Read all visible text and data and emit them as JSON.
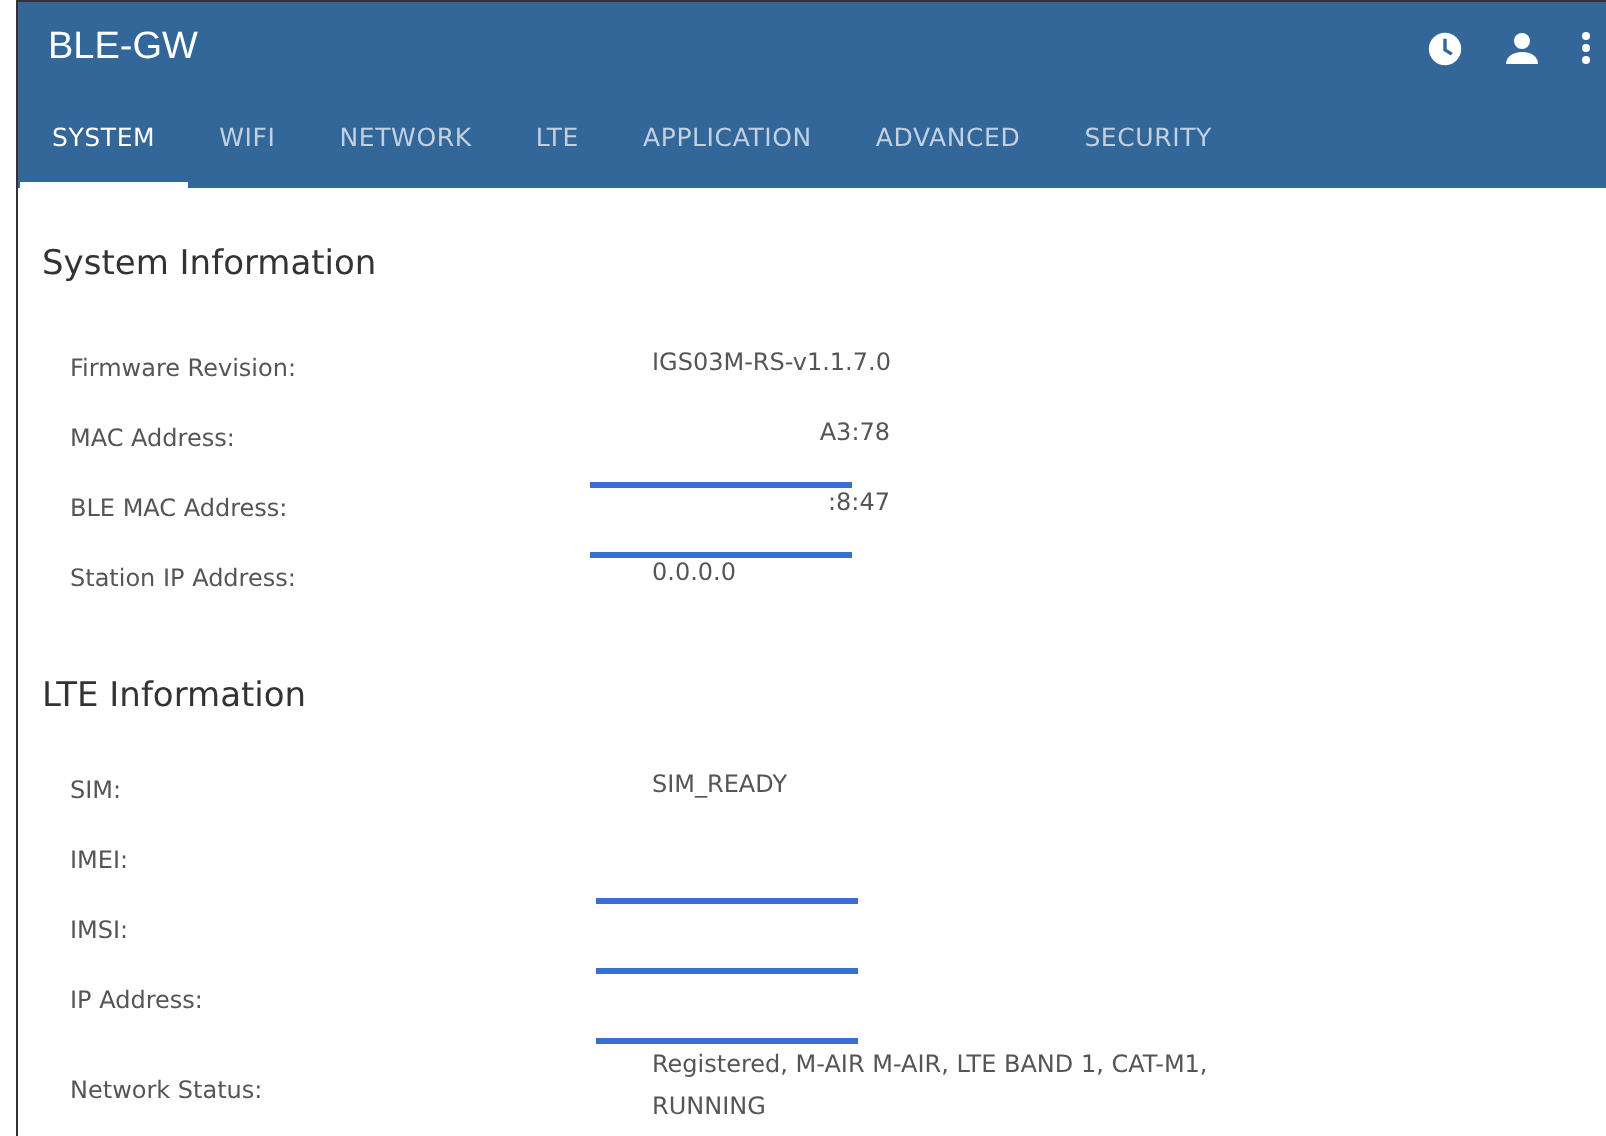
{
  "app_bar": {
    "title": "BLE-GW"
  },
  "tabs": [
    {
      "label": "SYSTEM",
      "selected": true
    },
    {
      "label": "WIFI",
      "selected": false
    },
    {
      "label": "NETWORK",
      "selected": false
    },
    {
      "label": "LTE",
      "selected": false
    },
    {
      "label": "APPLICATION",
      "selected": false
    },
    {
      "label": "ADVANCED",
      "selected": false
    },
    {
      "label": "SECURITY",
      "selected": false
    }
  ],
  "sections": [
    {
      "title": "System Information",
      "rows": [
        {
          "label": "Firmware Revision:",
          "value": "IGS03M-RS-v1.1.7.0",
          "redacted": false
        },
        {
          "label": "MAC Address:",
          "value": "A3:78",
          "redacted": true
        },
        {
          "label": "BLE MAC Address:",
          "value": ":8:47",
          "redacted": true
        },
        {
          "label": "Station IP Address:",
          "value": "0.0.0.0",
          "redacted": false
        }
      ]
    },
    {
      "title": "LTE Information",
      "rows": [
        {
          "label": "SIM:",
          "value": "SIM_READY",
          "redacted": false
        },
        {
          "label": "IMEI:",
          "redacted": true
        },
        {
          "label": "IMSI:",
          "redacted": true
        },
        {
          "label": "IP Address:",
          "redacted": true
        },
        {
          "label": "Network Status:",
          "value": "Registered, M-AIR M-AIR, LTE BAND 1, CAT-M1, RUNNING",
          "redacted": false
        }
      ]
    }
  ]
}
